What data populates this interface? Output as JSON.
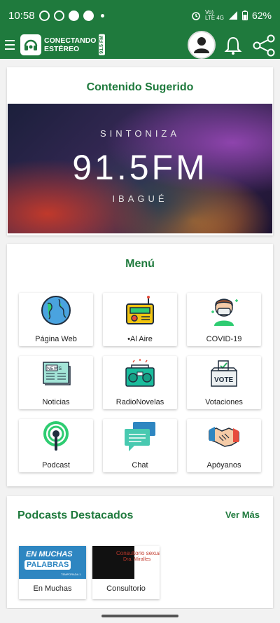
{
  "status_bar": {
    "time": "10:58",
    "battery": "62%",
    "network_top": "Vo)",
    "network_bottom": "LTE 4G"
  },
  "app": {
    "brand_line1": "CONECTANDO",
    "brand_line2": "ESTÉREO",
    "brand_freq": "91.5 FM",
    "accent_color": "#1f7a3d"
  },
  "suggested": {
    "title": "Contenido Sugerido",
    "banner_top": "SINTONIZA",
    "banner_freq": "91.5FM",
    "banner_city": "IBAGUÉ"
  },
  "menu": {
    "title": "Menú",
    "items": [
      {
        "label": "Página Web",
        "icon": "globe-icon"
      },
      {
        "label": "•Al Aire",
        "icon": "radio-icon"
      },
      {
        "label": "COVID-19",
        "icon": "face-mask-icon"
      },
      {
        "label": "Noticias",
        "icon": "newspaper-icon"
      },
      {
        "label": "RadioNovelas",
        "icon": "boombox-icon"
      },
      {
        "label": "Votaciones",
        "icon": "ballot-box-icon"
      },
      {
        "label": "Podcast",
        "icon": "podcast-icon"
      },
      {
        "label": "Chat",
        "icon": "chat-bubbles-icon"
      },
      {
        "label": "Apóyanos",
        "icon": "handshake-icon"
      }
    ]
  },
  "podcasts": {
    "title": "Podcasts Destacados",
    "see_more": "Ver Más",
    "items": [
      {
        "label": "En Muchas",
        "thumb_line1": "EN MUCHAS",
        "thumb_line2": "PALABRAS",
        "thumb_tag": "TEMPORADA 1"
      },
      {
        "label": "Consultorio",
        "thumb_line1": "Consultorio sexual",
        "thumb_line2": "Dra. Miralles"
      }
    ]
  }
}
